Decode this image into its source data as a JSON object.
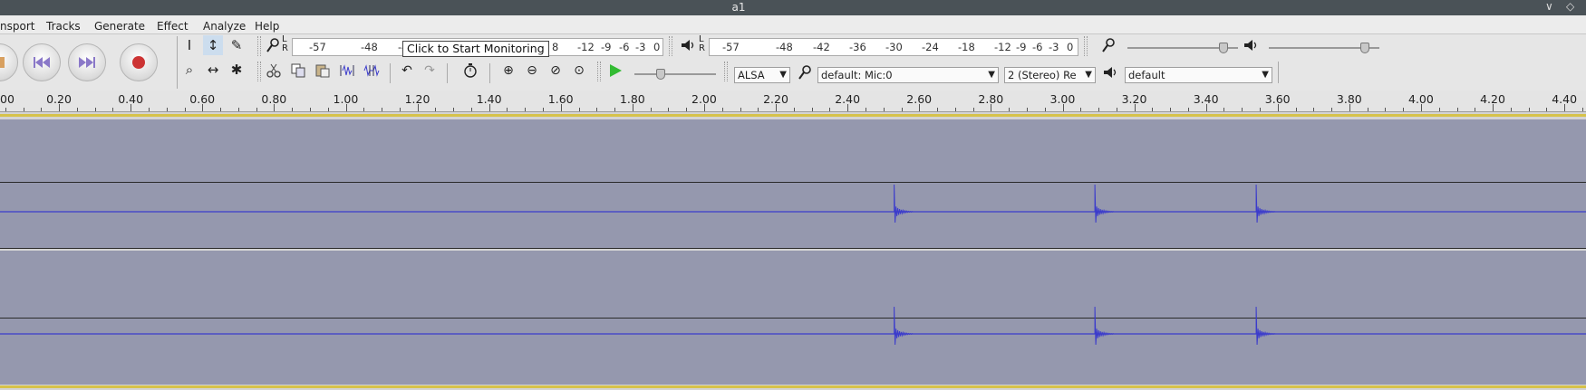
{
  "window": {
    "title": "a1",
    "minimize": "∨",
    "close": "◇"
  },
  "menu": [
    "nsport",
    "Tracks",
    "Generate",
    "Effect",
    "Analyze",
    "Help"
  ],
  "transport": {
    "buttons": [
      "stop",
      "skip-to-start",
      "skip-to-end",
      "record"
    ]
  },
  "tools": {
    "row1": [
      "I",
      "↕",
      "✎"
    ],
    "row2": [
      "⌕",
      "↔",
      "✱"
    ]
  },
  "record_meter": {
    "lr": "L\nR",
    "ticks_left": [
      "-57",
      "-48",
      "-4"
    ],
    "ticks_right": [
      "8",
      "-12",
      "-9",
      "-6",
      "-3",
      "0"
    ],
    "tooltip": "Click to Start Monitoring"
  },
  "play_meter": {
    "ticks": [
      "-57",
      "-48",
      "-42",
      "-36",
      "-30",
      "-24",
      "-18",
      "-12",
      "-9",
      "-6",
      "-3",
      "0"
    ]
  },
  "mixer": {
    "record_volume": 0.9,
    "playback_volume": 0.9
  },
  "edit_tools": [
    "cut",
    "copy",
    "paste",
    "trim",
    "silence",
    "undo",
    "redo",
    "timer",
    "zoom-in",
    "zoom-out",
    "fit-selection",
    "fit-project"
  ],
  "play_at_speed": {
    "speed": 0.3
  },
  "device": {
    "host": "ALSA",
    "recording_device": "default: Mic:0",
    "channels": "2 (Stereo) Re",
    "playback_device": "default"
  },
  "ruler": {
    "labels": [
      "00",
      "0.20",
      "0.40",
      "0.60",
      "0.80",
      "1.00",
      "1.20",
      "1.40",
      "1.60",
      "1.80",
      "2.00",
      "2.20",
      "2.40",
      "2.60",
      "2.80",
      "3.00",
      "3.20",
      "3.40",
      "3.60",
      "3.80",
      "4.00",
      "4.20",
      "4.40"
    ]
  },
  "track": {
    "wave_color": "#3b3bcc",
    "background_color": "#9598ae",
    "spikes_seconds": [
      2.53,
      3.09,
      3.54
    ]
  }
}
